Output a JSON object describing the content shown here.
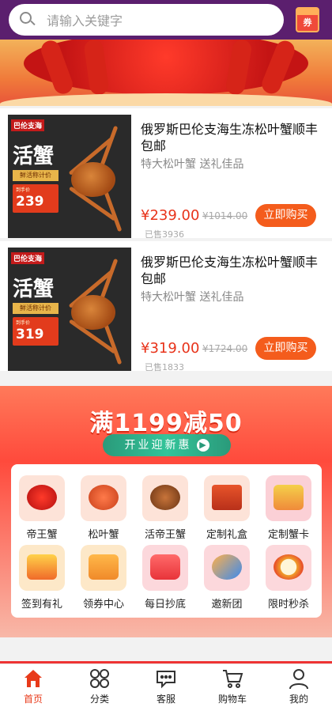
{
  "search": {
    "placeholder": "请输入关键字"
  },
  "coupon_label": "券",
  "products": [
    {
      "title": "俄罗斯巴伦支海生冻松叶蟹顺丰包邮",
      "subtitle": "特大松叶蟹 送礼佳品",
      "price": "¥239.00",
      "original_price": "¥1014.00",
      "sold": "已售3936",
      "buy_label": "立即购买",
      "thumb": {
        "brand": "巴伦支海",
        "headline": "活蟹",
        "tag": "鲜活称计价",
        "price_label": "到手价",
        "price": "239"
      }
    },
    {
      "title": "俄罗斯巴伦支海生冻松叶蟹顺丰包邮",
      "subtitle": "特大松叶蟹 送礼佳品",
      "price": "¥319.00",
      "original_price": "¥1724.00",
      "sold": "已售1833",
      "buy_label": "立即购买",
      "thumb": {
        "brand": "巴伦支海",
        "headline": "活蟹",
        "tag": "鲜活称计价",
        "price_label": "到手价",
        "price": "319"
      }
    }
  ],
  "promo": {
    "headline": "满1199减50",
    "cta": "开业迎新惠",
    "categories": [
      {
        "label": "帝王蟹",
        "icon": "king-crab-icon"
      },
      {
        "label": "松叶蟹",
        "icon": "snow-crab-icon"
      },
      {
        "label": "活帝王蟹",
        "icon": "live-king-crab-icon"
      },
      {
        "label": "定制礼盒",
        "icon": "gift-box-icon"
      },
      {
        "label": "定制蟹卡",
        "icon": "crab-card-icon"
      },
      {
        "label": "签到有礼",
        "icon": "sign-in-gift-icon"
      },
      {
        "label": "领券中心",
        "icon": "coupon-center-icon"
      },
      {
        "label": "每日抄底",
        "icon": "daily-deal-icon"
      },
      {
        "label": "邀新团",
        "icon": "invite-group-icon"
      },
      {
        "label": "限时秒杀",
        "icon": "flash-sale-icon"
      }
    ]
  },
  "nav": [
    {
      "label": "首页",
      "icon": "home-icon",
      "active": true
    },
    {
      "label": "分类",
      "icon": "category-icon",
      "active": false
    },
    {
      "label": "客服",
      "icon": "service-icon",
      "active": false
    },
    {
      "label": "购物车",
      "icon": "cart-icon",
      "active": false
    },
    {
      "label": "我的",
      "icon": "profile-icon",
      "active": false
    }
  ],
  "colors": {
    "accent": "#e8331a",
    "buy_button": "#f45c1c",
    "header": "#5b1f6e"
  }
}
